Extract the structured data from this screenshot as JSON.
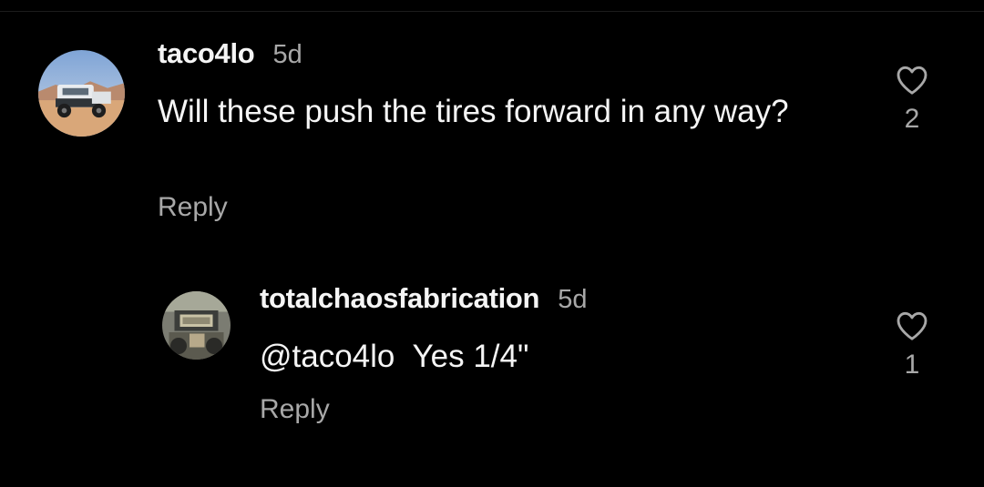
{
  "comments": [
    {
      "username": "taco4lo",
      "age": "5d",
      "text": "Will these push the tires forward in any way?",
      "reply_label": "Reply",
      "likes": "2"
    },
    {
      "username": "totalchaosfabrication",
      "age": "5d",
      "mention": "@taco4lo",
      "text": "Yes 1/4\"",
      "reply_label": "Reply",
      "likes": "1"
    }
  ],
  "icons": {
    "like": "heart-outline-icon",
    "avatar_1": "truck-photo",
    "avatar_2": "fabrication-photo"
  },
  "colors": {
    "background": "#000000",
    "primary_text": "#f5f5f5",
    "secondary_text": "#a8a8a8"
  }
}
